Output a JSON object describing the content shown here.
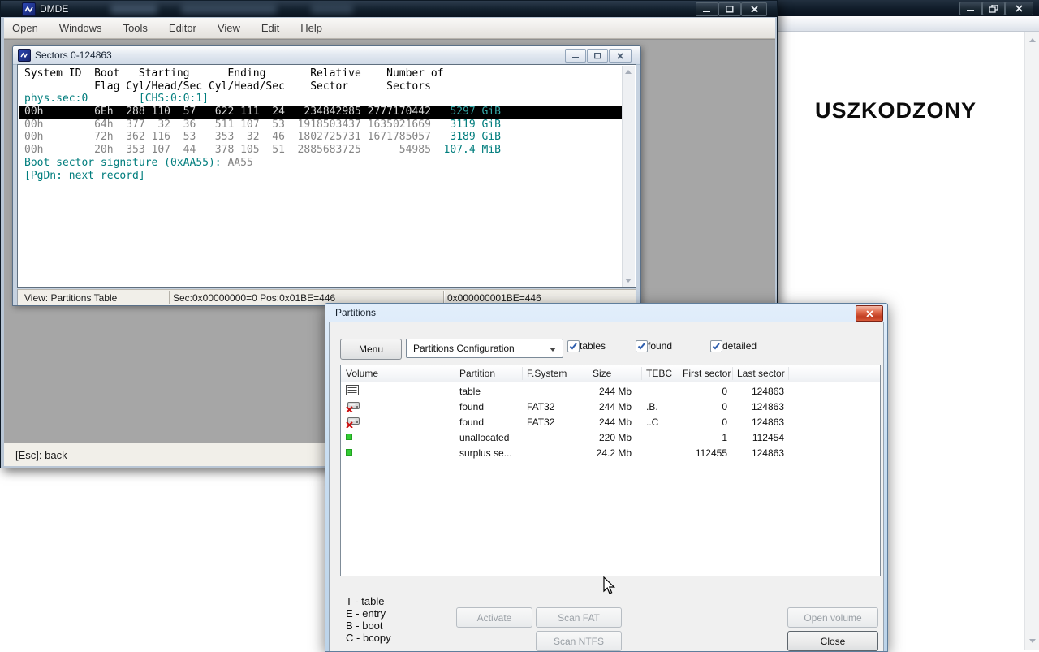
{
  "colors": {
    "teal": "#007d7d",
    "selected_teal": "#36a9a9",
    "row_gray": "#848484",
    "selected_fg": "#dcdcdc",
    "mdi_gray": "#a6a6a6",
    "close_red": "#bf3a1f"
  },
  "background_window": {
    "content_text": "USZKODZONY"
  },
  "dmde": {
    "title": "DMDE",
    "menu_items": [
      "Open",
      "Windows",
      "Tools",
      "Editor",
      "View",
      "Edit",
      "Help"
    ],
    "status_text": "[Esc]: back"
  },
  "sectors": {
    "title": "Sectors 0-124863",
    "lines": [
      {
        "kind": "header",
        "text": "System ID  Boot   Starting      Ending       Relative    Number of"
      },
      {
        "kind": "header",
        "text": "           Flag Cyl/Head/Sec Cyl/Head/Sec    Sector      Sectors"
      },
      {
        "kind": "info",
        "text": "phys.sec:0        [CHS:0:0:1]"
      },
      {
        "kind": "row",
        "selected": true,
        "main": "00h        6Eh  288 110  57   622 111  24   234842985 2777170442",
        "size": "   5297 GiB"
      },
      {
        "kind": "row",
        "selected": false,
        "main": "00h        64h  377  32  36   511 107  53  1918503437 1635021669",
        "size": "   3119 GiB"
      },
      {
        "kind": "row",
        "selected": false,
        "main": "00h        72h  362 116  53   353  32  46  1802725731 1671785057",
        "size": "   3189 GiB"
      },
      {
        "kind": "row",
        "selected": false,
        "main": "00h        20h  353 107  44   378 105  51  2885683725      54985",
        "size": "  107.4 MiB"
      },
      {
        "kind": "sig",
        "label": "Boot sector signature (0xAA55): ",
        "value": "AA55"
      },
      {
        "kind": "info",
        "text": "[PgDn: next record]"
      }
    ],
    "status_sections": [
      "View: Partitions Table",
      "Sec:0x00000000=0 Pos:0x01BE=446",
      "0x000000001BE=446"
    ]
  },
  "partitions": {
    "title": "Partitions",
    "menu_button": "Menu",
    "config_selected": "Partitions Configuration",
    "checkboxes": [
      {
        "label": "tables",
        "checked": true
      },
      {
        "label": "found",
        "checked": true
      },
      {
        "label": "detailed",
        "checked": true
      }
    ],
    "table": {
      "headers": [
        "Volume",
        "Partition",
        "F.System",
        "Size",
        "TEBC",
        "First sector",
        "Last sector"
      ],
      "rows": [
        {
          "icon": "table-icon",
          "partition": "table",
          "fsystem": "",
          "size": "244 Mb",
          "tebc": "",
          "first_sector": "0",
          "last_sector": "124863"
        },
        {
          "icon": "volume-deleted-icon",
          "partition": "found",
          "fsystem": "FAT32",
          "size": "244 Mb",
          "tebc": ".B.",
          "first_sector": "0",
          "last_sector": "124863"
        },
        {
          "icon": "volume-deleted-icon",
          "partition": "found",
          "fsystem": "FAT32",
          "size": "244 Mb",
          "tebc": "..C",
          "first_sector": "0",
          "last_sector": "124863"
        },
        {
          "icon": "unallocated-icon",
          "partition": "unallocated",
          "fsystem": "",
          "size": "220 Mb",
          "tebc": "",
          "first_sector": "1",
          "last_sector": "112454"
        },
        {
          "icon": "unallocated-icon",
          "partition": "surplus se...",
          "fsystem": "",
          "size": "24.2 Mb",
          "tebc": "",
          "first_sector": "112455",
          "last_sector": "124863"
        }
      ]
    },
    "legend": [
      "T - table",
      "E - entry",
      "B - boot",
      "C - bcopy"
    ],
    "buttons": {
      "activate": {
        "label": "Activate",
        "enabled": false
      },
      "scan_fat": {
        "label": "Scan FAT",
        "enabled": false
      },
      "scan_ntfs": {
        "label": "Scan NTFS",
        "enabled": false
      },
      "open_volume": {
        "label": "Open volume",
        "enabled": false
      },
      "close": {
        "label": "Close",
        "enabled": true
      }
    }
  }
}
